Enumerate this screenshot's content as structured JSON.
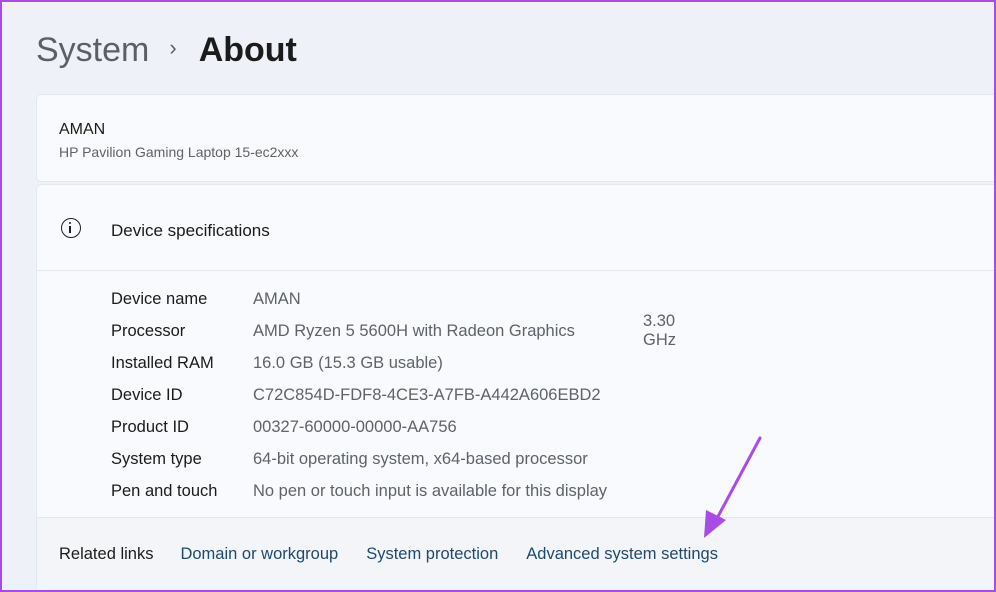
{
  "breadcrumb": {
    "parent": "System",
    "separator": "›",
    "current": "About"
  },
  "device": {
    "name": "AMAN",
    "model": "HP Pavilion Gaming Laptop 15-ec2xxx"
  },
  "specifications": {
    "title": "Device specifications",
    "icon": "info-icon",
    "rows": [
      {
        "label": "Device name",
        "value": "AMAN"
      },
      {
        "label": "Processor",
        "value": "AMD Ryzen 5 5600H with Radeon Graphics",
        "extra": "3.30 GHz"
      },
      {
        "label": "Installed RAM",
        "value": "16.0 GB (15.3 GB usable)"
      },
      {
        "label": "Device ID",
        "value": "C72C854D-FDF8-4CE3-A7FB-A442A606EBD2"
      },
      {
        "label": "Product ID",
        "value": "00327-60000-00000-AA756"
      },
      {
        "label": "System type",
        "value": "64-bit operating system, x64-based processor"
      },
      {
        "label": "Pen and touch",
        "value": "No pen or touch input is available for this display"
      }
    ]
  },
  "related_links": {
    "label": "Related links",
    "links": [
      "Domain or workgroup",
      "System protection",
      "Advanced system settings"
    ]
  },
  "colors": {
    "annotation": "#a94be6",
    "link": "#1d4a70"
  }
}
